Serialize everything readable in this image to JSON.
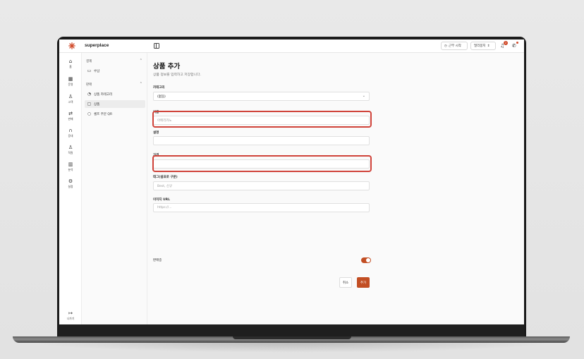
{
  "app": {
    "brand": "superplace",
    "accent": "#c24e23"
  },
  "topbar": {
    "start_work": "근무 시작",
    "store": "멀리몽지",
    "notification_count": "2"
  },
  "rail": [
    {
      "icon": "home-icon",
      "glyph": "⌂",
      "label": "홈"
    },
    {
      "icon": "calendar-icon",
      "glyph": "▦",
      "label": "운영"
    },
    {
      "icon": "customer-icon",
      "glyph": "♙",
      "label": "고객"
    },
    {
      "icon": "sales-icon",
      "glyph": "⇄",
      "label": "판매"
    },
    {
      "icon": "headset-icon",
      "glyph": "∩",
      "label": "응대"
    },
    {
      "icon": "staff-icon",
      "glyph": "♙",
      "label": "직원"
    },
    {
      "icon": "analytics-icon",
      "glyph": "▥",
      "label": "분석"
    },
    {
      "icon": "settings-icon",
      "glyph": "⚙",
      "label": "설정"
    }
  ],
  "rail_logout": {
    "glyph": "↦",
    "label": "나가기"
  },
  "subnav": {
    "sections": [
      {
        "title": "결제",
        "items": [
          {
            "glyph": "▭",
            "label": "수납",
            "active": false
          }
        ]
      },
      {
        "title": "판매",
        "items": [
          {
            "glyph": "◔",
            "label": "상품 카테고리",
            "active": false
          },
          {
            "glyph": "▢",
            "label": "상품",
            "active": true
          },
          {
            "glyph": "○",
            "label": "셀프 주문 QR",
            "active": false
          }
        ]
      }
    ]
  },
  "form": {
    "title": "상품 추가",
    "subtitle": "상품 정보를 입력하고 저장합니다.",
    "category_label": "카테고리",
    "category_value": "(없음)",
    "name_label": "이름",
    "name_placeholder": "아메리카노",
    "description_label": "설명",
    "description_value": "",
    "price_label": "가격",
    "price_value": "",
    "tags_label": "태그(쉼표로 구분)",
    "tags_placeholder": "Best, 신규",
    "image_label": "이미지 URL",
    "image_placeholder": "https://...",
    "on_sale_label": "판매중",
    "on_sale": true,
    "cancel_label": "취소",
    "add_label": "추가"
  }
}
